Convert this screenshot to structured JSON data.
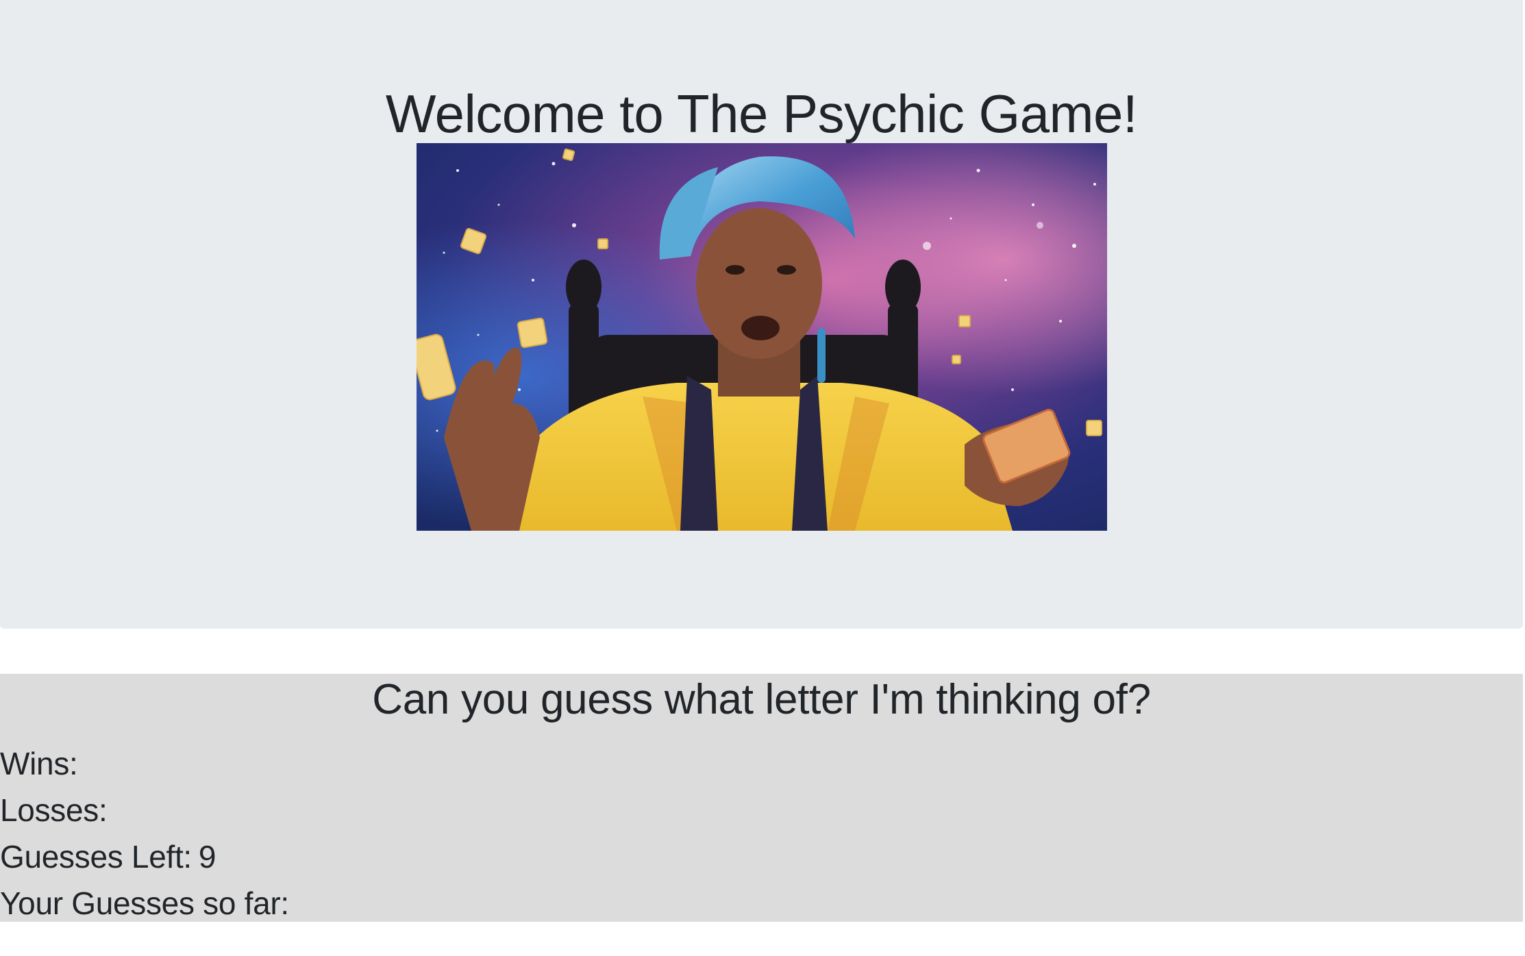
{
  "header": {
    "title": "Welcome to The Psychic Game!"
  },
  "hero_image": {
    "description_icon": "psychic-woman-image"
  },
  "game": {
    "question": "Can you guess what letter I'm thinking of?",
    "stats": {
      "wins_label": "Wins:",
      "wins_value": "",
      "losses_label": "Losses:",
      "losses_value": "",
      "guesses_left_label": "Guesses Left:",
      "guesses_left_value": "9",
      "guesses_so_far_label": "Your Guesses so far:",
      "guesses_so_far_value": ""
    }
  },
  "colors": {
    "jumbotron_bg": "#e9ecef",
    "panel_bg": "#dcdcdc",
    "text": "#212529"
  }
}
